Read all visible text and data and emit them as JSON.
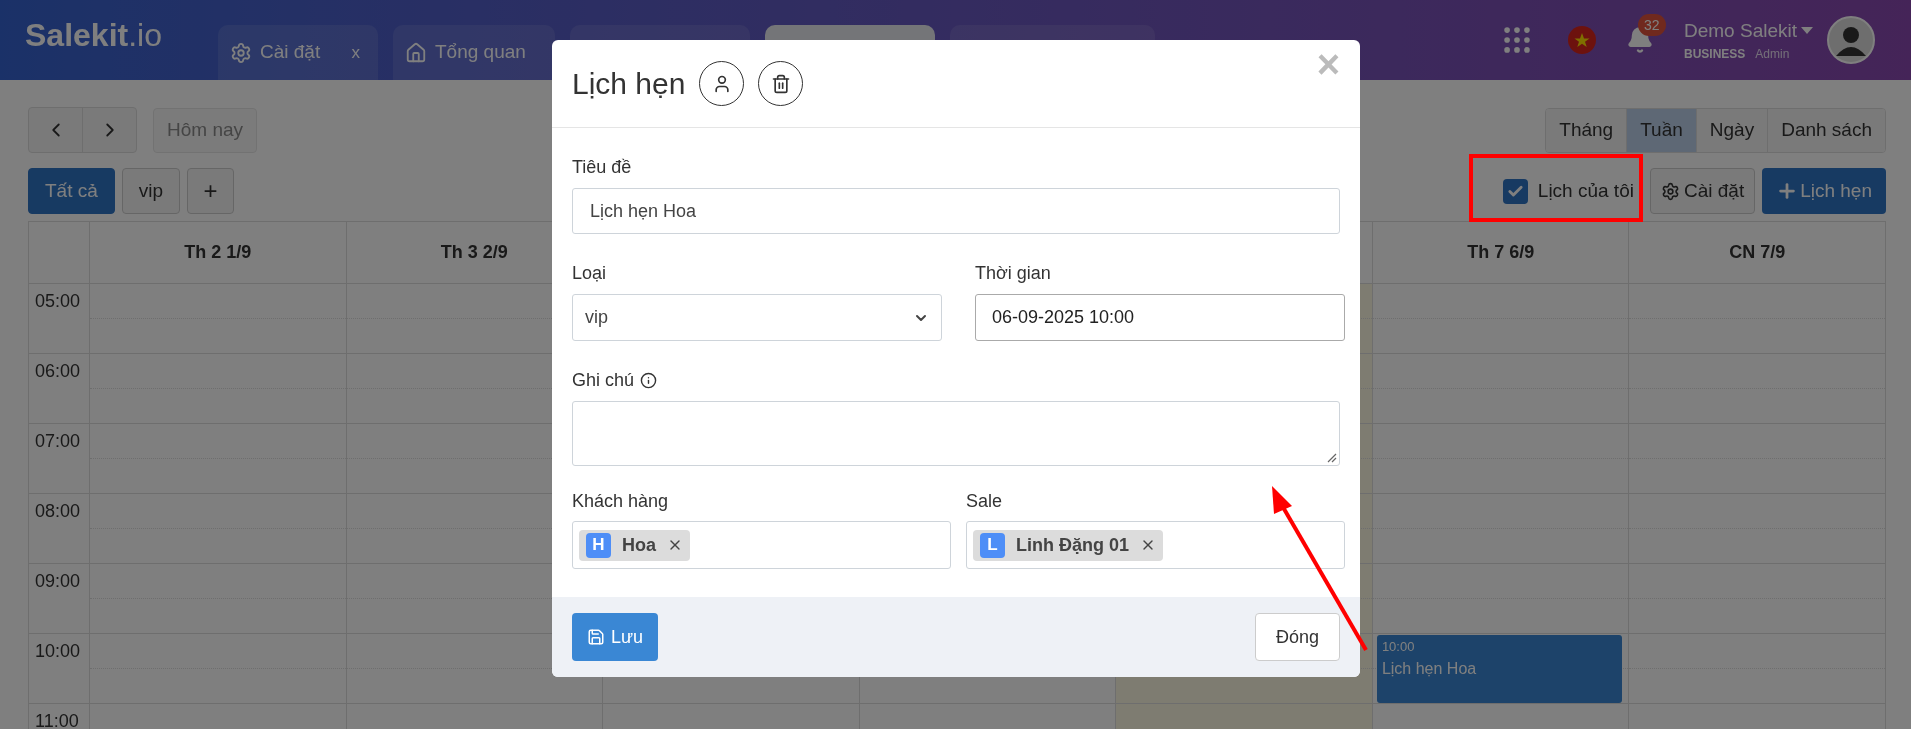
{
  "app_bar": {
    "logo": "**Salekit**.io",
    "tabs": [
      {
        "kind": "settings",
        "label": "Cài đặt",
        "close": "x",
        "selected": false
      },
      {
        "kind": "home",
        "label": "Tổng quan",
        "selected": false
      },
      {
        "kind": "blank",
        "selected": false
      },
      {
        "kind": "blank",
        "selected": true
      },
      {
        "kind": "blank",
        "selected": false
      }
    ],
    "notifications": {
      "count": "32"
    },
    "user": {
      "name": "Demo Salekit",
      "plan": "BUSINESS",
      "role": "Admin"
    }
  },
  "toolbar": {
    "today_button": {
      "label": "Hôm nay",
      "disabled": true
    },
    "views": [
      {
        "label": "Tháng",
        "selected": false
      },
      {
        "label": "Tuần",
        "selected": true
      },
      {
        "label": "Ngày",
        "selected": false
      },
      {
        "label": "Danh sách",
        "selected": false
      }
    ],
    "filters": [
      {
        "label": "Tất cả",
        "selected": true
      },
      {
        "label": "vip",
        "selected": false
      }
    ],
    "add_filter": "+",
    "my_calendar": {
      "label": "Lịch của tôi",
      "checked": true
    },
    "settings_button": "Cài đặt",
    "new_button": "Lịch hẹn"
  },
  "calendar": {
    "days": [
      {
        "header": "Th 2 1/9",
        "today": false
      },
      {
        "header": "Th 3 2/9",
        "today": false
      },
      {
        "today": false
      },
      {
        "today": false
      },
      {
        "today": true
      },
      {
        "header": "Th 7 6/9",
        "today": false,
        "events": [
          {
            "time": "10:00",
            "title": "Lịch hẹn Hoa"
          }
        ]
      },
      {
        "header": "CN 7/9",
        "today": false
      }
    ],
    "hours": [
      "05:00",
      "06:00",
      "07:00",
      "08:00",
      "09:00",
      "10:00",
      "11:00"
    ]
  },
  "modal": {
    "title": "Lịch hẹn",
    "close": "×",
    "title_field": {
      "label": "Tiêu đề",
      "value": "Lịch hẹn Hoa"
    },
    "type_field": {
      "label": "Loại",
      "value": "vip"
    },
    "time_field": {
      "label": "Thời gian",
      "value": "06-09-2025 10:00"
    },
    "note_field": {
      "label": "Ghi chú"
    },
    "customer_field": {
      "label": "Khách hàng",
      "tags": [
        {
          "initial": "H",
          "label": "Hoa"
        }
      ]
    },
    "sale_field": {
      "label": "Sale",
      "tags": [
        {
          "initial": "L",
          "label": "Linh Đặng 01"
        }
      ]
    },
    "save_button": "Lưu",
    "close_button": "Đóng"
  },
  "annotations": {
    "highlight_box": true,
    "arrow": true
  }
}
